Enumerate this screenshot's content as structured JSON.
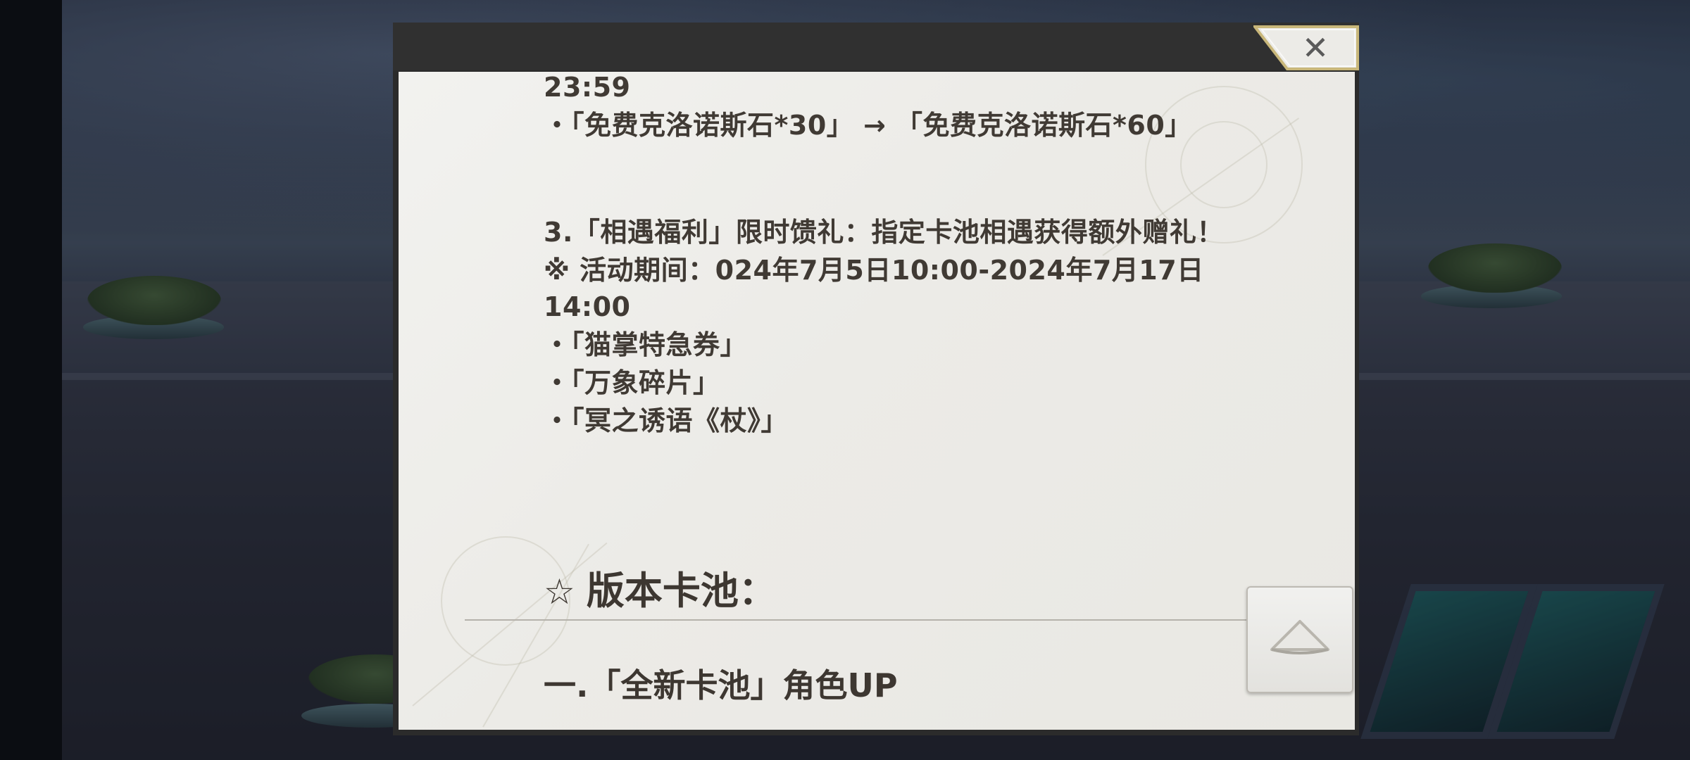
{
  "notice": {
    "lines": [
      "23:59",
      "・「免费克洛诺斯石*30」 → 「免费克洛诺斯石*60」",
      "3.「相遇福利」限时馈礼：指定卡池相遇获得额外赠礼！",
      "※ 活动期间：024年7月5日10:00-2024年7月17日",
      "14:00",
      "・「猫掌特急券」",
      "・「万象碎片」",
      "・「冥之诱语《杖》」"
    ],
    "section_heading": {
      "star": "☆",
      "text": "版本卡池："
    },
    "sub_heading": "一.「全新卡池」角色UP"
  },
  "controls": {
    "close_glyph": "✕",
    "scroll_top_icon": "triangle-up-icon"
  },
  "colors": {
    "text": "#403a34",
    "dialog_header": "#303030",
    "dialog_body": "#efeeea",
    "close_accent": "#c9b77a"
  }
}
